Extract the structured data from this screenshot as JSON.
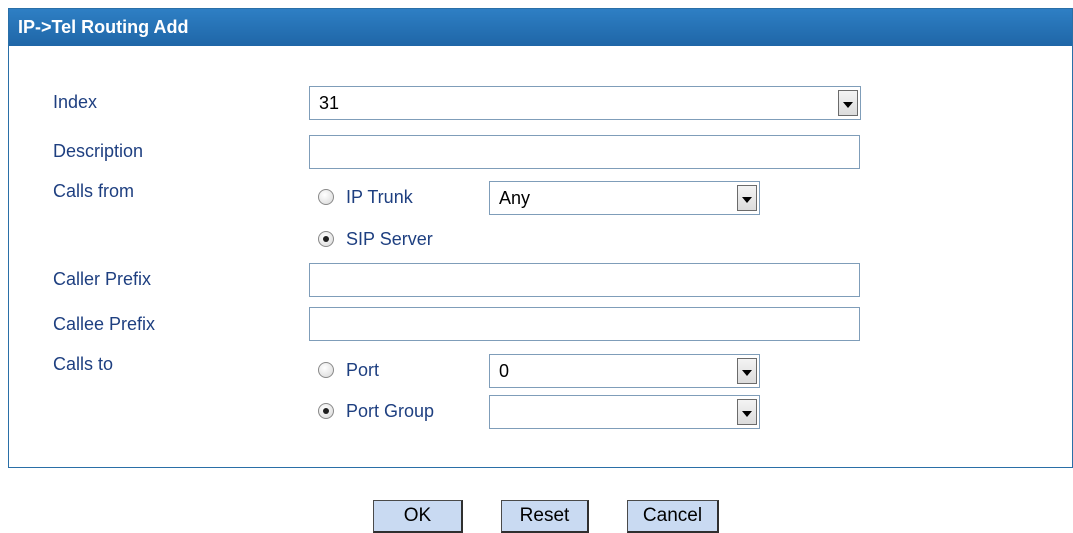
{
  "panel": {
    "title": "IP->Tel Routing Add"
  },
  "form": {
    "index": {
      "label": "Index",
      "value": "31"
    },
    "description": {
      "label": "Description",
      "value": ""
    },
    "calls_from": {
      "label": "Calls from",
      "ip_trunk": {
        "label": "IP Trunk",
        "selected": false,
        "dropdown_value": "Any"
      },
      "sip_server": {
        "label": "SIP Server",
        "selected": true
      }
    },
    "caller_prefix": {
      "label": "Caller Prefix",
      "value": ""
    },
    "callee_prefix": {
      "label": "Callee Prefix",
      "value": ""
    },
    "calls_to": {
      "label": "Calls to",
      "port": {
        "label": "Port",
        "selected": false,
        "dropdown_value": "0"
      },
      "port_group": {
        "label": "Port Group",
        "selected": true,
        "dropdown_value": ""
      }
    }
  },
  "buttons": {
    "ok": "OK",
    "reset": "Reset",
    "cancel": "Cancel"
  }
}
